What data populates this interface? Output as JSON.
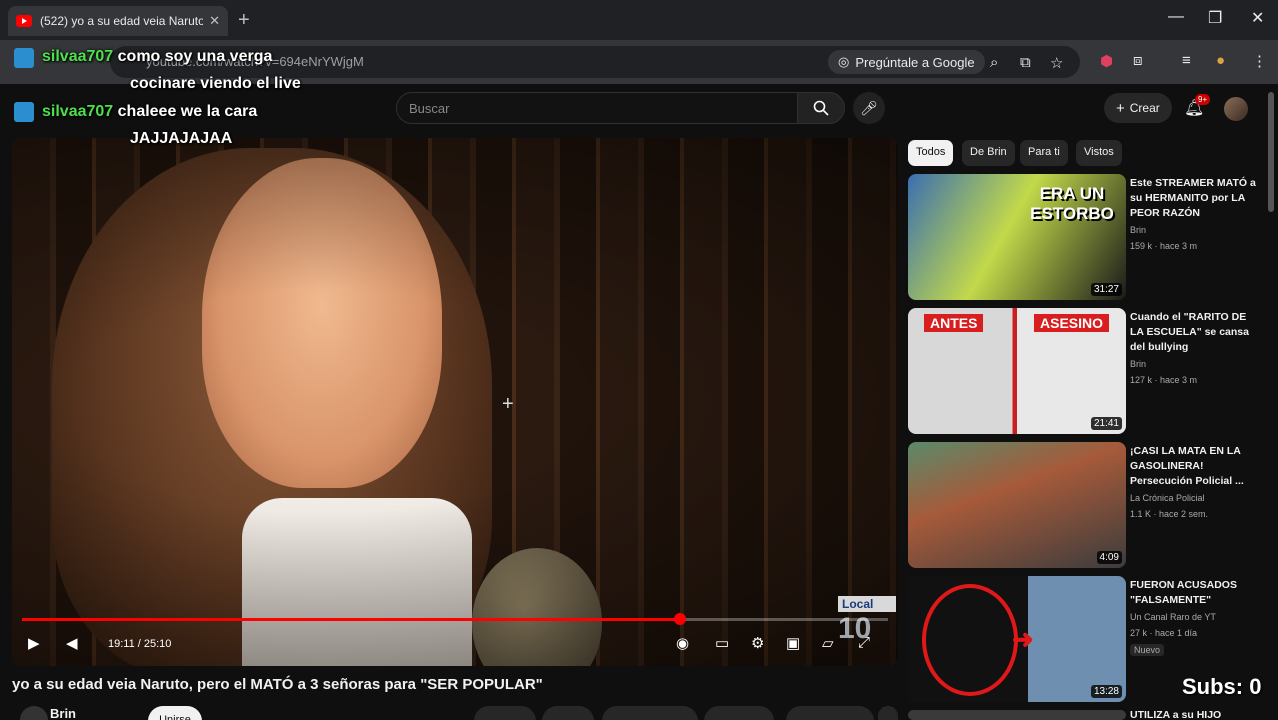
{
  "browser": {
    "tab_title": "(522) yo a su edad veia Naruto,",
    "tab_close": "✕",
    "new_tab": "+",
    "url": "youtube.com/watch?v=694eNrYWjgM",
    "google_button": "Pregúntale a Google",
    "win_minimize": "—",
    "win_maximize": "❐",
    "win_close": "✕"
  },
  "youtube_header": {
    "search_placeholder": "Buscar",
    "create_label": "Crear",
    "notif_count": "9+"
  },
  "chat_overlay": [
    {
      "user": "silvaa707",
      "message": "como soy una verga"
    },
    {
      "user": "",
      "message": "cocinare viendo el live"
    },
    {
      "user": "silvaa707",
      "message": "chaleee we la cara"
    },
    {
      "user": "",
      "message": "JAJJAJAJAA"
    }
  ],
  "player": {
    "time": "19:11 / 25:10",
    "progress_fraction": 0.76,
    "station_label": "Local",
    "station_number": "10"
  },
  "video": {
    "title": "yo a su edad veia Naruto, pero el MATÓ a 3 señoras para \"SER POPULAR\"",
    "channel": "Brin",
    "subscribe_label": "Unirse"
  },
  "chips": [
    "Todos",
    "De Brin",
    "Para ti",
    "Vistos"
  ],
  "recommendations": [
    {
      "title": "Este STREAMER MATÓ a su HERMANITO por LA PEOR RAZÓN",
      "channel": "Brin",
      "meta": "159 k · hace 3 m",
      "duration": "31:27",
      "caption": "ERA UN ESTORBO",
      "new": ""
    },
    {
      "title": "Cuando el \"RARITO DE LA ESCUELA\" se cansa del bullying",
      "channel": "Brin",
      "meta": "127 k · hace 3 m",
      "duration": "21:41",
      "caption_left": "ANTES",
      "caption_right": "ASESINO",
      "new": ""
    },
    {
      "title": "¡CASI LA MATA EN LA GASOLINERA! Persecución Policial ...",
      "channel": "La Crónica Policial",
      "meta": "1.1 K · hace 2 sem.",
      "duration": "4:09",
      "new": ""
    },
    {
      "title": "FUERON ACUSADOS \"FALSAMENTE\"",
      "channel": "Un Canal Raro de YT",
      "meta": "27 k · hace 1 día",
      "duration": "13:28",
      "new": "Nuevo"
    },
    {
      "title": "UTILIZA a su HIJO",
      "channel": "",
      "meta": "",
      "duration": "",
      "new": ""
    }
  ],
  "subs_counter": "Subs: 0"
}
